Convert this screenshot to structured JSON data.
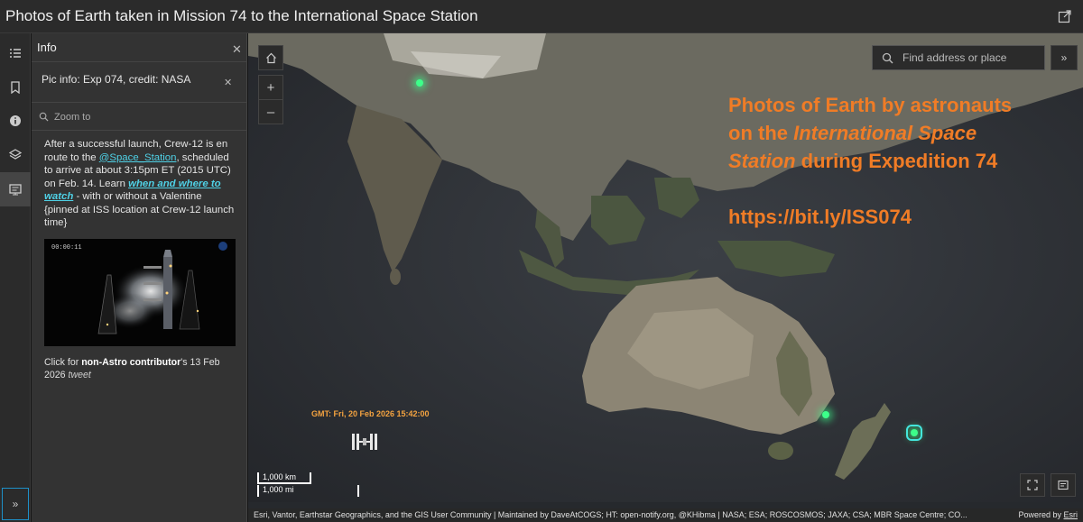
{
  "header": {
    "title": "Photos of Earth taken in Mission 74 to the International Space Station"
  },
  "panel": {
    "title": "Info",
    "pic_info": "Pic info: Exp 074, credit: NASA",
    "zoom_to": "Zoom to",
    "body": {
      "p1": "After a successful launch, Crew-12 is en route to the ",
      "handle": "@Space_Station",
      "p2": ", scheduled to arrive at about 3:15pm ET (2015 UTC) on Feb. 14. Learn ",
      "link": "when and where to watch",
      "p3": " - with or without a Valentine {pinned at ISS location at Crew-12 launch time}"
    },
    "thumb_timer": "00:00:11",
    "credit": {
      "prefix": "Click for ",
      "name": "non-Astro contributor",
      "suffix": "'s 13 Feb 2026 ",
      "tweet": "tweet"
    }
  },
  "map": {
    "search_placeholder": "Find address or place",
    "overlay": {
      "line1": "Photos of Earth by astronauts",
      "line2_pre": "on the ",
      "line2_italic": "International Space",
      "line3_italic": "Station",
      "line3_post": " during Expedition 74",
      "link": "https://bit.ly/ISS074",
      "color": "#f07c26"
    },
    "gmt_label": "GMT: Fri, 20 Feb 2026 15:42:00",
    "scale_km": "1,000 km",
    "scale_mi": "1,000 mi",
    "attribution": "Esri, Vantor, Earthstar Geographics, and the GIS User Community | Maintained by DaveAtCOGS; HT: open-notify.org, @KHibma | NASA; ESA; ROSCOSMOS; JAXA; CSA; MBR Space Centre; CO...",
    "powered_prefix": "Powered by ",
    "powered_link": "Esri"
  },
  "icons": {
    "header": [
      "share-icon"
    ],
    "rail": [
      "list-icon",
      "bookmark-icon",
      "info-icon",
      "layers-icon",
      "slideshow-icon",
      "expand-icon"
    ],
    "map": [
      "home-icon",
      "zoom-in-icon",
      "zoom-out-icon",
      "search-icon",
      "fullscreen-icon",
      "legend-icon"
    ]
  }
}
